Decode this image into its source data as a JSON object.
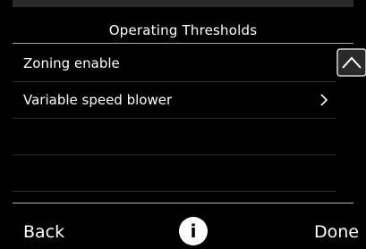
{
  "header": {
    "title": "Operating Thresholds"
  },
  "list": {
    "items": [
      {
        "label": "Zoning enable",
        "has_chevron": false
      },
      {
        "label": "Variable speed blower",
        "has_chevron": true
      }
    ],
    "empty_rows": 2
  },
  "scrollbar": {
    "up_icon": "chevron-up-icon"
  },
  "footer": {
    "back_label": "Back",
    "info_label": "i",
    "done_label": "Done"
  },
  "colors": {
    "background": "#000000",
    "text": "#ffffff",
    "divider": "#2c2c2c",
    "rule": "#a8a8a8"
  }
}
